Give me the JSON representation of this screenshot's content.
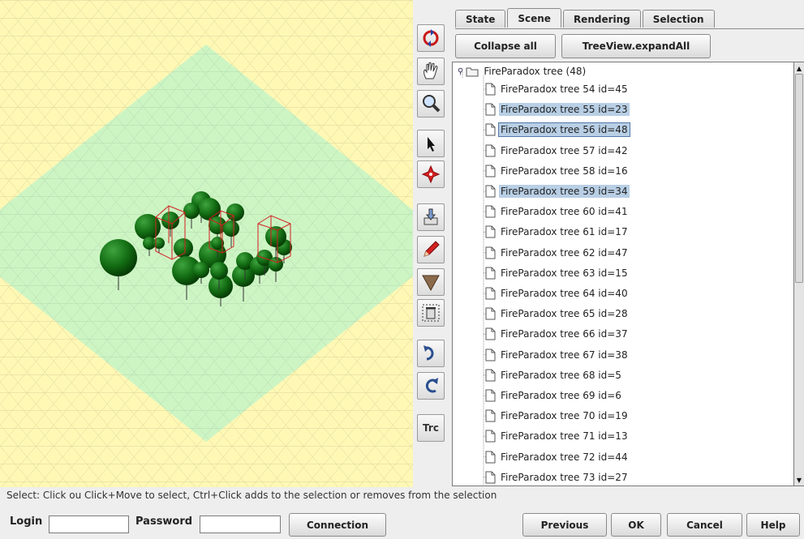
{
  "toolbar": {
    "buttons": [
      {
        "icon": "rotate-icon"
      },
      {
        "icon": "hand-pan-icon"
      },
      {
        "icon": "zoom-magnifier-icon"
      },
      {
        "icon": "select-arrow-icon"
      },
      {
        "icon": "move-star-icon"
      },
      {
        "icon": "import-icon"
      },
      {
        "icon": "pencil-edit-icon"
      },
      {
        "icon": "triangle-icon"
      },
      {
        "icon": "trash-icon"
      },
      {
        "icon": "redo-icon"
      },
      {
        "icon": "refresh-icon"
      }
    ],
    "trc_label": "Trc"
  },
  "tabs": [
    {
      "label": "State",
      "active": false
    },
    {
      "label": "Scene",
      "active": true
    },
    {
      "label": "Rendering",
      "active": false
    },
    {
      "label": "Selection",
      "active": false
    }
  ],
  "panel": {
    "collapse_label": "Collapse all",
    "expand_label": "TreeView.expandAll"
  },
  "tree": {
    "root_label": "FireParadox tree (48)",
    "items": [
      {
        "label": "FireParadox tree 54 id=45",
        "selected": false,
        "focus": false
      },
      {
        "label": "FireParadox tree 55 id=23",
        "selected": true,
        "focus": false
      },
      {
        "label": "FireParadox tree 56 id=48",
        "selected": true,
        "focus": true
      },
      {
        "label": "FireParadox tree 57 id=42",
        "selected": false,
        "focus": false
      },
      {
        "label": "FireParadox tree 58 id=16",
        "selected": false,
        "focus": false
      },
      {
        "label": "FireParadox tree 59 id=34",
        "selected": true,
        "focus": false
      },
      {
        "label": "FireParadox tree 60 id=41",
        "selected": false,
        "focus": false
      },
      {
        "label": "FireParadox tree 61 id=17",
        "selected": false,
        "focus": false
      },
      {
        "label": "FireParadox tree 62 id=47",
        "selected": false,
        "focus": false
      },
      {
        "label": "FireParadox tree 63 id=15",
        "selected": false,
        "focus": false
      },
      {
        "label": "FireParadox tree 64 id=40",
        "selected": false,
        "focus": false
      },
      {
        "label": "FireParadox tree 65 id=28",
        "selected": false,
        "focus": false
      },
      {
        "label": "FireParadox tree 66 id=37",
        "selected": false,
        "focus": false
      },
      {
        "label": "FireParadox tree 67 id=38",
        "selected": false,
        "focus": false
      },
      {
        "label": "FireParadox tree 68 id=5",
        "selected": false,
        "focus": false
      },
      {
        "label": "FireParadox tree 69 id=6",
        "selected": false,
        "focus": false
      },
      {
        "label": "FireParadox tree 70 id=19",
        "selected": false,
        "focus": false
      },
      {
        "label": "FireParadox tree 71 id=13",
        "selected": false,
        "focus": false
      },
      {
        "label": "FireParadox tree 72 id=44",
        "selected": false,
        "focus": false
      },
      {
        "label": "FireParadox tree 73 id=27",
        "selected": false,
        "focus": false
      }
    ]
  },
  "status": "Select: Click ou Click+Move to select, Ctrl+Click adds to the selection or removes from the selection",
  "bottom": {
    "login_label": "Login",
    "login_value": "",
    "password_label": "Password",
    "password_value": "",
    "connection_label": "Connection",
    "previous_label": "Previous",
    "ok_label": "OK",
    "cancel_label": "Cancel",
    "help_label": "Help"
  },
  "colors": {
    "outer_ground": "#fff8b5",
    "inner_ground": "#cdf5c4",
    "tree_green": "#0f6e0f",
    "selection_box": "#d42020",
    "tree_selection": "#b8cfe5"
  }
}
